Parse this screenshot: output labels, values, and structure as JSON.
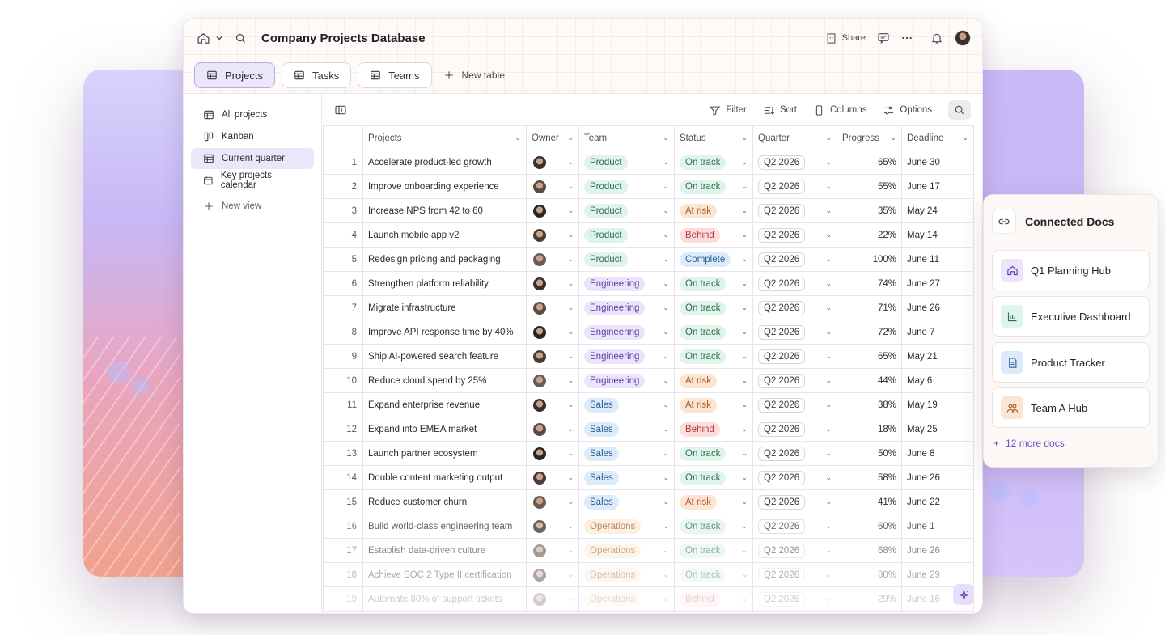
{
  "app": {
    "title": "Company Projects Database",
    "share_label": "Share"
  },
  "tabs": [
    {
      "label": "Projects",
      "active": true
    },
    {
      "label": "Tasks",
      "active": false
    },
    {
      "label": "Teams",
      "active": false
    }
  ],
  "new_table_label": "New table",
  "sidebar": {
    "items": [
      {
        "label": "All projects",
        "icon": "table-icon"
      },
      {
        "label": "Kanban",
        "icon": "kanban-icon"
      },
      {
        "label": "Current quarter",
        "icon": "table-icon",
        "active": true
      },
      {
        "label": "Key projects calendar",
        "icon": "calendar-icon"
      }
    ],
    "new_view_label": "New view"
  },
  "toolbar": {
    "filter": "Filter",
    "sort": "Sort",
    "columns": "Columns",
    "options": "Options"
  },
  "table": {
    "columns": [
      "Projects",
      "Owner",
      "Team",
      "Status",
      "Quarter",
      "Progress",
      "Deadline"
    ],
    "rows": [
      {
        "n": "1",
        "name": "Accelerate product-led growth",
        "team": "Product",
        "status": "On track",
        "quarter": "Q2 2026",
        "progress": "65%",
        "deadline": "June 30"
      },
      {
        "n": "2",
        "name": "Improve onboarding experience",
        "team": "Product",
        "status": "On track",
        "quarter": "Q2 2026",
        "progress": "55%",
        "deadline": "June 17"
      },
      {
        "n": "3",
        "name": "Increase NPS from 42 to 60",
        "team": "Product",
        "status": "At risk",
        "quarter": "Q2 2026",
        "progress": "35%",
        "deadline": "May 24"
      },
      {
        "n": "4",
        "name": "Launch mobile app v2",
        "team": "Product",
        "status": "Behind",
        "quarter": "Q2 2026",
        "progress": "22%",
        "deadline": "May 14"
      },
      {
        "n": "5",
        "name": "Redesign pricing and packaging",
        "team": "Product",
        "status": "Complete",
        "quarter": "Q2 2026",
        "progress": "100%",
        "deadline": "June 11"
      },
      {
        "n": "6",
        "name": "Strengthen platform reliability",
        "team": "Engineering",
        "status": "On track",
        "quarter": "Q2 2026",
        "progress": "74%",
        "deadline": "June 27"
      },
      {
        "n": "7",
        "name": "Migrate infrastructure",
        "team": "Engineering",
        "status": "On track",
        "quarter": "Q2 2026",
        "progress": "71%",
        "deadline": "June 26"
      },
      {
        "n": "8",
        "name": "Improve API response time by 40%",
        "team": "Engineering",
        "status": "On track",
        "quarter": "Q2 2026",
        "progress": "72%",
        "deadline": "June 7"
      },
      {
        "n": "9",
        "name": "Ship AI-powered search feature",
        "team": "Engineering",
        "status": "On track",
        "quarter": "Q2 2026",
        "progress": "65%",
        "deadline": "May 21"
      },
      {
        "n": "10",
        "name": "Reduce cloud spend by 25%",
        "team": "Engineering",
        "status": "At risk",
        "quarter": "Q2 2026",
        "progress": "44%",
        "deadline": "May 6"
      },
      {
        "n": "11",
        "name": "Expand enterprise revenue",
        "team": "Sales",
        "status": "At risk",
        "quarter": "Q2 2026",
        "progress": "38%",
        "deadline": "May 19"
      },
      {
        "n": "12",
        "name": "Expand into EMEA market",
        "team": "Sales",
        "status": "Behind",
        "quarter": "Q2 2026",
        "progress": "18%",
        "deadline": "May 25"
      },
      {
        "n": "13",
        "name": "Launch partner ecosystem",
        "team": "Sales",
        "status": "On track",
        "quarter": "Q2 2026",
        "progress": "50%",
        "deadline": "June 8"
      },
      {
        "n": "14",
        "name": "Double content marketing output",
        "team": "Sales",
        "status": "On track",
        "quarter": "Q2 2026",
        "progress": "58%",
        "deadline": "June 26"
      },
      {
        "n": "15",
        "name": "Reduce customer churn",
        "team": "Sales",
        "status": "At risk",
        "quarter": "Q2 2026",
        "progress": "41%",
        "deadline": "June 22"
      },
      {
        "n": "16",
        "name": "Build world-class engineering team",
        "team": "Operations",
        "status": "On track",
        "quarter": "Q2 2026",
        "progress": "60%",
        "deadline": "June 1"
      },
      {
        "n": "17",
        "name": "Establish data-driven culture",
        "team": "Operations",
        "status": "On track",
        "quarter": "Q2 2026",
        "progress": "68%",
        "deadline": "June 26"
      },
      {
        "n": "18",
        "name": "Achieve SOC 2 Type II certification",
        "team": "Operations",
        "status": "On track",
        "quarter": "Q2 2026",
        "progress": "80%",
        "deadline": "June 29"
      },
      {
        "n": "19",
        "name": "Automate 80% of support tickets",
        "team": "Operations",
        "status": "Behind",
        "quarter": "Q2 2026",
        "progress": "29%",
        "deadline": "June 16"
      }
    ]
  },
  "team_colors": {
    "Product": {
      "bg": "#dff4ea",
      "fg": "#2f6a4c"
    },
    "Engineering": {
      "bg": "#ece4fb",
      "fg": "#5a3fa8"
    },
    "Sales": {
      "bg": "#dcebfa",
      "fg": "#2d5f92"
    },
    "Operations": {
      "bg": "#fdecd9",
      "fg": "#a0612a"
    }
  },
  "status_colors": {
    "On track": {
      "bg": "#dff4ea",
      "fg": "#2f6a4c"
    },
    "At risk": {
      "bg": "#fde5d4",
      "fg": "#b05426"
    },
    "Behind": {
      "bg": "#fcdcdc",
      "fg": "#b03a3a"
    },
    "Complete": {
      "bg": "#dcebfa",
      "fg": "#2d5f92"
    }
  },
  "connected_docs": {
    "title": "Connected Docs",
    "docs": [
      {
        "label": "Q1 Planning Hub",
        "icon": "home-icon",
        "color": "#ece4fb"
      },
      {
        "label": "Executive Dashboard",
        "icon": "bar-chart-icon",
        "color": "#dff4ea"
      },
      {
        "label": "Product Tracker",
        "icon": "document-icon",
        "color": "#dcebfa"
      },
      {
        "label": "Team A Hub",
        "icon": "people-icon",
        "color": "#fde5d4"
      }
    ],
    "more_label": "12 more docs"
  }
}
